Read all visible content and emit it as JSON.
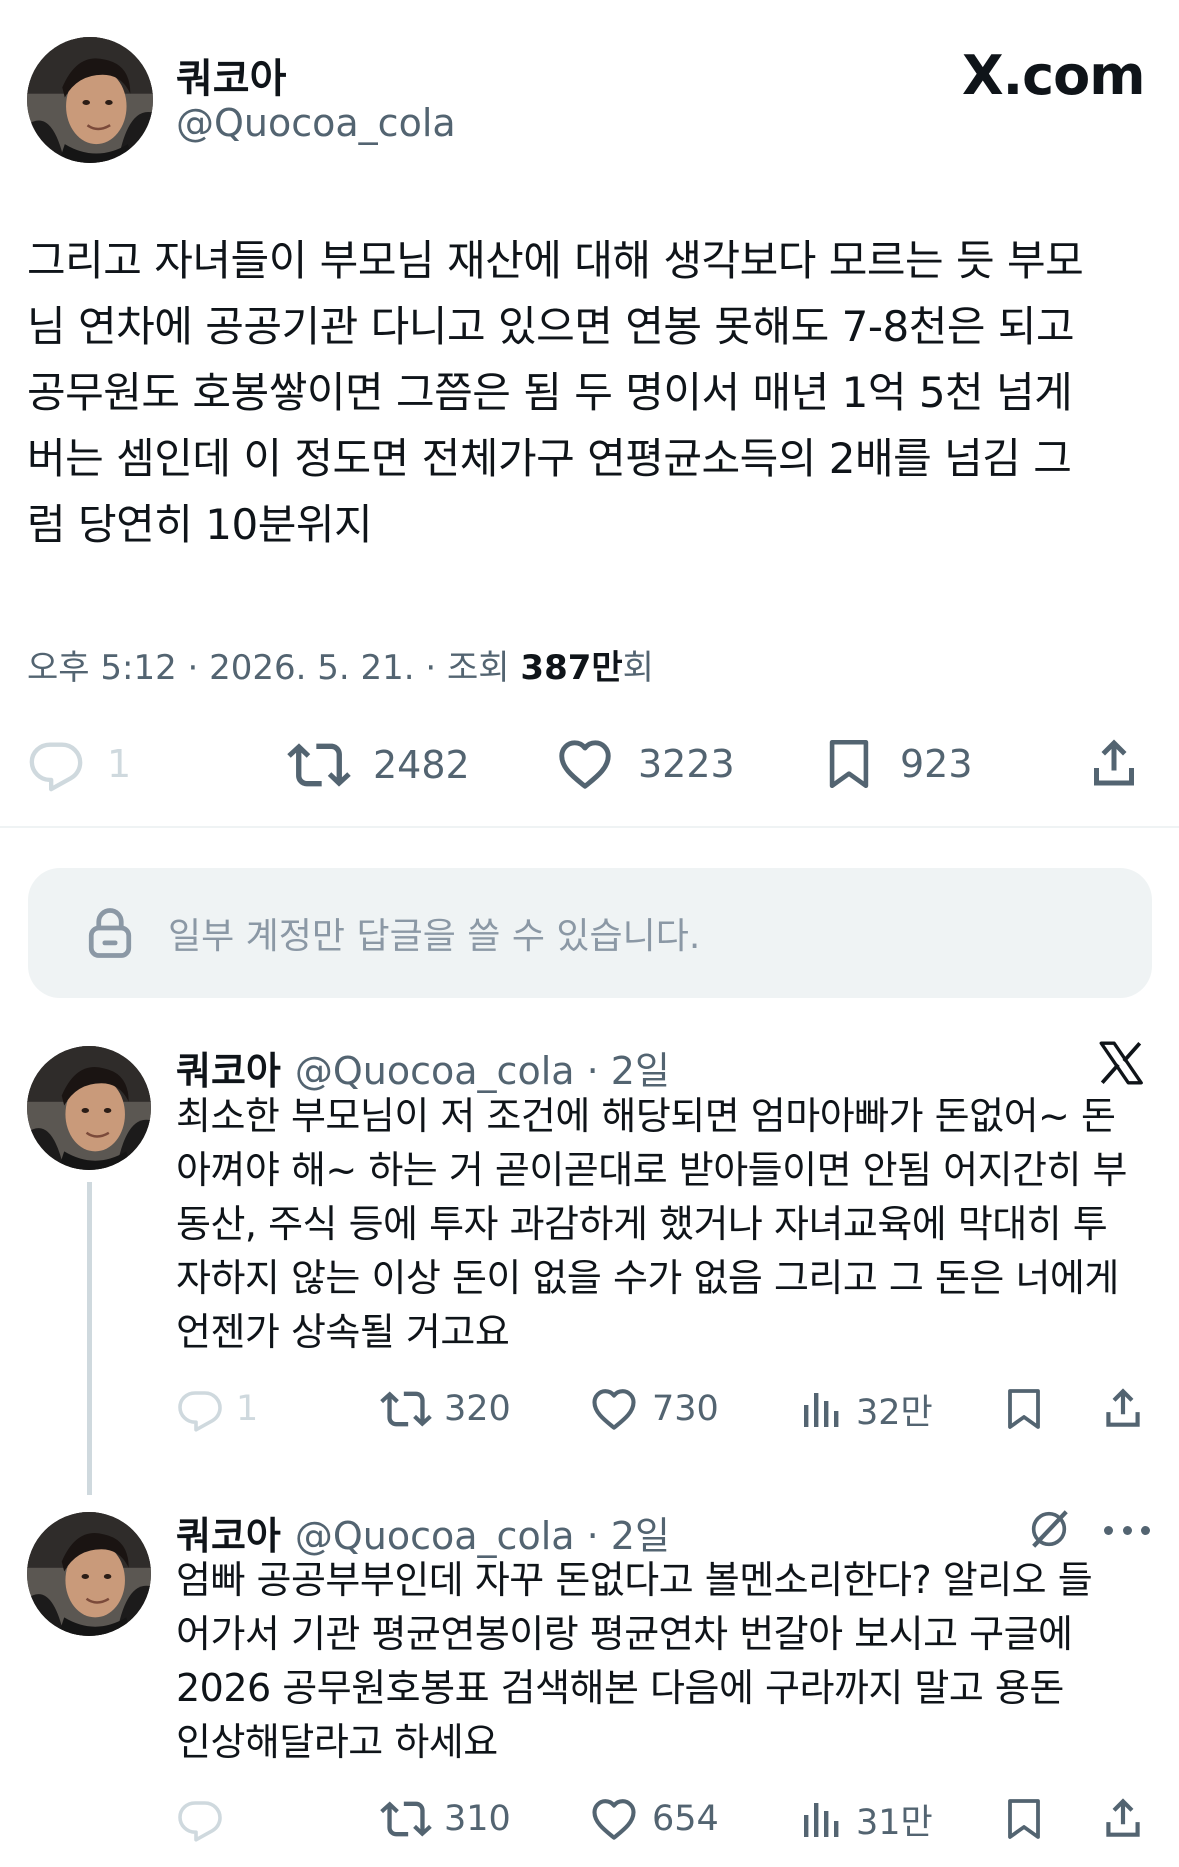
{
  "tweet": {
    "author_name": "쿼코아",
    "author_handle": "@Quocoa_cola",
    "site_label": "X.com",
    "text_lines": [
      "그리고 자녀들이 부모님 재산에 대해 생각보다 모르는 듯 부모",
      "님 연차에 공공기관 다니고 있으면 연봉 못해도 7-8천은 되고",
      "공무원도 호봉쌓이면 그쯤은 됨 두 명이서 매년 1억 5천 넘게",
      "버는 셈인데 이 정도면 전체가구 연평균소득의 2배를 넘김 그",
      "럼 당연히 10분위지"
    ],
    "meta_prefix": "오후 5:12 · 2026. 5. 21. · 조회 ",
    "meta_views": "387만",
    "meta_suffix": "회",
    "stats": {
      "replies": "1",
      "retweets": "2482",
      "likes": "3223",
      "bookmarks": "923"
    }
  },
  "restriction_notice": "일부 계정만 답글을 쓸 수 있습니다.",
  "replies": [
    {
      "author_name": "쿼코아",
      "handle_time": "@Quocoa_cola · 2일",
      "text_lines": [
        "최소한 부모님이 저 조건에 해당되면 엄마아빠가 돈없어~ 돈",
        "아껴야 해~ 하는 거 곧이곧대로 받아들이면 안됨 어지간히 부",
        "동산, 주식 등에 투자 과감하게 했거나 자녀교육에 막대히 투",
        "자하지 않는 이상 돈이 없을 수가 없음 그리고 그 돈은 너에게",
        "언젠가 상속될 거고요"
      ],
      "stats": {
        "replies": "1",
        "retweets": "320",
        "likes": "730",
        "views": "32만"
      }
    },
    {
      "author_name": "쿼코아",
      "handle_time": "@Quocoa_cola · 2일",
      "text_lines": [
        "엄빠 공공부부인데 자꾸 돈없다고 볼멘소리한다? 알리오 들",
        "어가서 기관 평균연봉이랑 평균연차 번갈아 보시고 구글에",
        "2026 공무원호봉표 검색해본 다음에 구라까지 말고 용돈",
        "인상해달라고 하세요"
      ],
      "stats": {
        "retweets": "310",
        "likes": "654",
        "views": "31만"
      }
    }
  ],
  "icons": {
    "reply": "reply-icon",
    "retweet": "retweet-icon",
    "like": "heart-icon",
    "bookmark": "bookmark-icon",
    "share": "share-icon",
    "views": "views-icon",
    "lock": "lock-icon",
    "x_logo": "x-logo-icon",
    "grok": "grok-icon",
    "more": "more-icon"
  },
  "colors": {
    "text": "#0f1419",
    "secondary": "#536471",
    "faint": "#cfd9de",
    "notice_bg": "#eff3f4"
  }
}
